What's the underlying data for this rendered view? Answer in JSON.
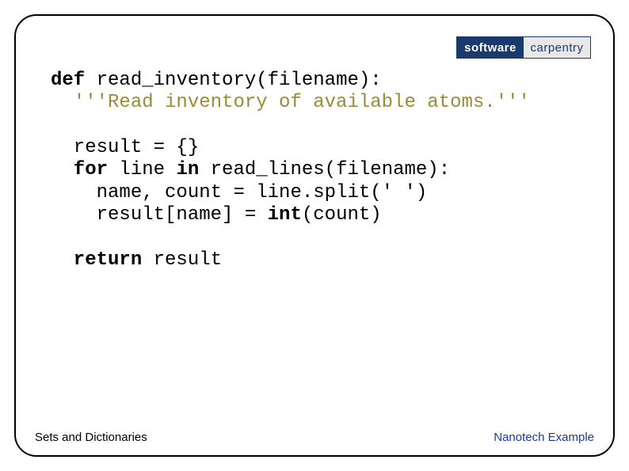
{
  "logo": {
    "left": "software",
    "right": "carpentry"
  },
  "code": {
    "line1_kw": "def",
    "line1_rest": " read_inventory(filename):",
    "line2_docstring": "  '''Read inventory of available atoms.'''",
    "line3_empty": "",
    "line4": "  result = {}",
    "line5_kw1": "  for",
    "line5_mid": " line ",
    "line5_kw2": "in",
    "line5_rest": " read_lines(filename):",
    "line6": "    name, count = line.split(' ')",
    "line7_pre": "    result[name] = ",
    "line7_kw": "int",
    "line7_post": "(count)",
    "line8_empty": "",
    "line9_kw": "  return",
    "line9_rest": " result"
  },
  "footer": {
    "left": "Sets and Dictionaries",
    "right": "Nanotech Example"
  }
}
